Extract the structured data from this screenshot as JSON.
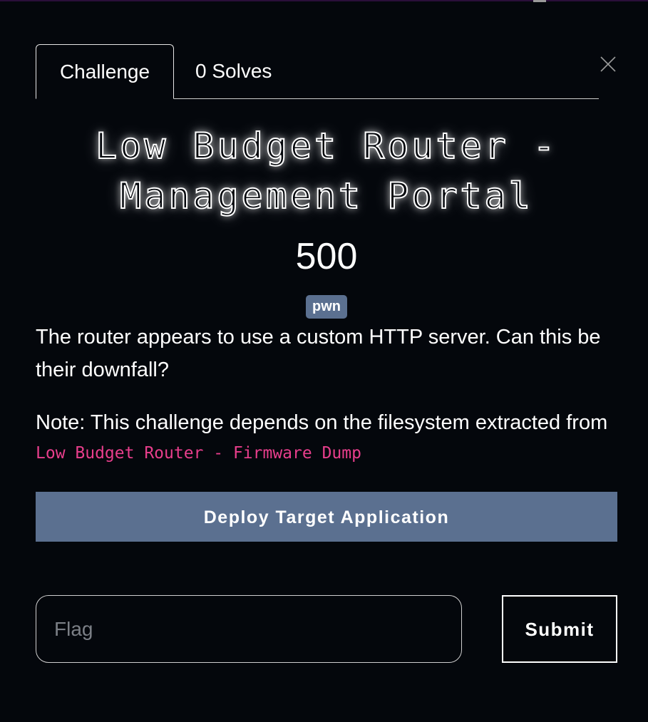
{
  "tabs": {
    "challenge_label": "Challenge",
    "solves_label": "0 Solves",
    "active": "Challenge"
  },
  "close": {
    "icon": "close-icon"
  },
  "challenge": {
    "name": "Low Budget Router - Management Portal",
    "value": "500",
    "tag": "pwn",
    "description_line1": "The router appears to use a custom HTTP server. Can this be their downfall?",
    "description_note": "Note: This challenge depends on the filesystem extracted from",
    "description_code": "Low Budget Router - Firmware Dump"
  },
  "deploy_button": {
    "label": "Deploy Target Application"
  },
  "flag_form": {
    "placeholder": "Flag",
    "value": "",
    "submit_label": "Submit"
  },
  "colors": {
    "background": "#04070c",
    "accent": "#5b7090",
    "code": "#e83e8c",
    "text": "#ffffff"
  }
}
